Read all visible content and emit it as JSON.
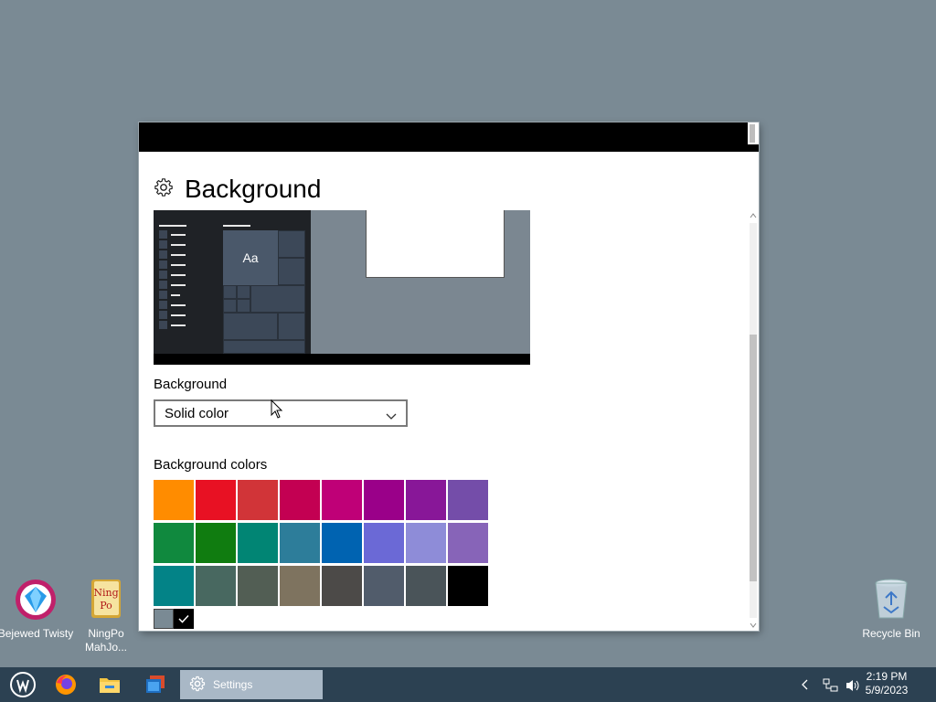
{
  "desktop": {
    "icons": [
      {
        "label": "Bejewed Twisty"
      },
      {
        "label": "NingPo MahJo..."
      },
      {
        "label": "Recycle Bin"
      }
    ]
  },
  "window": {
    "title": "Background",
    "preview": {
      "tile_text": "Aa"
    },
    "background_label": "Background",
    "dropdown_value": "Solid color",
    "colors_label": "Background colors",
    "colors": [
      [
        "#ff8c00",
        "#e81123",
        "#d13438",
        "#c30052",
        "#bf0077",
        "#9a0089",
        "#881798",
        "#744da9"
      ],
      [
        "#10893e",
        "#107c10",
        "#018574",
        "#2d7d9a",
        "#0063b1",
        "#6b69d6",
        "#8e8cd8",
        "#8764b8"
      ],
      [
        "#038387",
        "#486860",
        "#525e54",
        "#7e735f",
        "#4c4a48",
        "#515c6b",
        "#4a5459",
        "#000000"
      ]
    ],
    "selected_color": "#7a8a94"
  },
  "taskbar": {
    "active_app": "Settings",
    "time": "2:19 PM",
    "date": "5/9/2023"
  }
}
